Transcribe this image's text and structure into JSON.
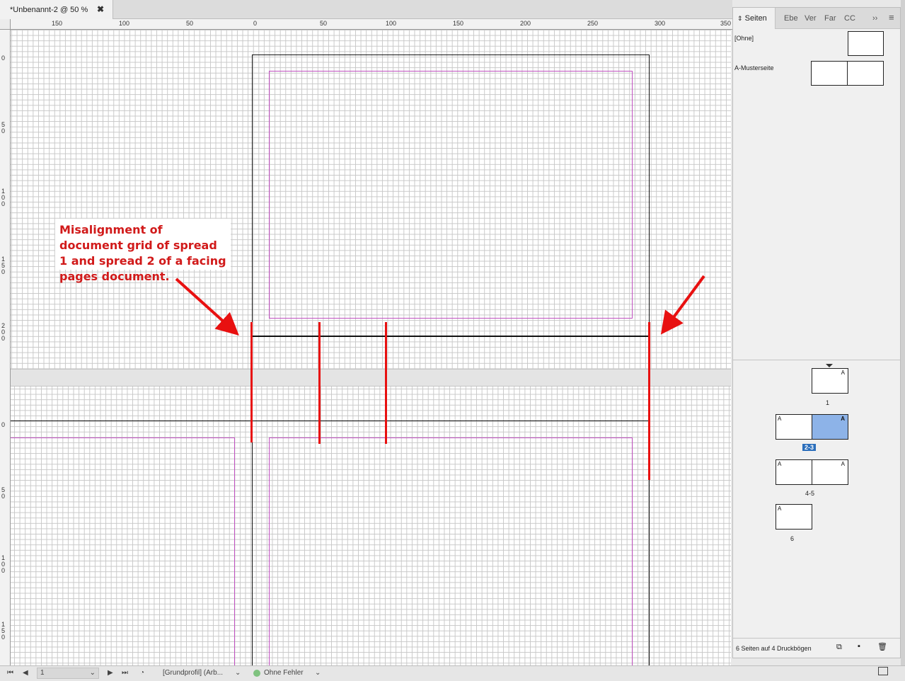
{
  "document": {
    "tab_title": "*Unbenannt-2 @ 50 %",
    "close_glyph": "✖"
  },
  "rulers": {
    "horizontal": [
      "150",
      "100",
      "50",
      "0",
      "50",
      "100",
      "150",
      "200",
      "250",
      "300",
      "350"
    ],
    "vertical_top": [
      "0",
      "5\n0",
      "1\n0\n0",
      "1\n5\n0",
      "2\n0\n0"
    ],
    "vertical_bottom": [
      "0",
      "5\n0",
      "1\n0\n0",
      "1\n5\n0"
    ]
  },
  "annotation": {
    "text": "Misalignment of document grid of spread 1 and spread 2 of a facing pages document.",
    "color": "#e81010"
  },
  "panel": {
    "tabs": [
      "Seiten",
      "Ebe",
      "Ver",
      "Far",
      "CC"
    ],
    "overflow_glyph": "››",
    "menu_glyph": "≡",
    "masters": [
      {
        "label": "[Ohne]"
      },
      {
        "label": "A-Musterseite"
      }
    ],
    "spreads": [
      {
        "number": "1",
        "letters": [
          "A"
        ]
      },
      {
        "number": "2-3",
        "letters": [
          "A",
          "A"
        ],
        "selected": true
      },
      {
        "number": "4-5",
        "letters": [
          "A",
          "A"
        ]
      },
      {
        "number": "6",
        "letters": [
          "A"
        ]
      }
    ],
    "footer_text": "6 Seiten auf 4 Druckbögen",
    "selection_color": "#8db3e8"
  },
  "statusbar": {
    "page_value": "1",
    "profile": "[Grundprofil] (Arb...",
    "preflight": "Ohne Fehler",
    "preflight_color": "#7fc27f"
  }
}
